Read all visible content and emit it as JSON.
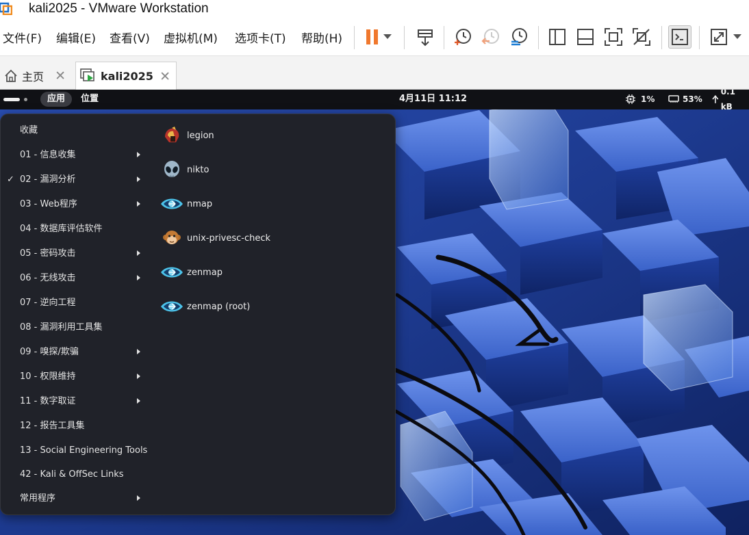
{
  "window": {
    "title": "kali2025 - VMware Workstation"
  },
  "menubar": {
    "items": [
      "文件(F)",
      "编辑(E)",
      "查看(V)",
      "虚拟机(M)",
      "选项卡(T)",
      "帮助(H)"
    ]
  },
  "toolbar": {
    "buttons": [
      "pause-icon",
      "dropdown-arrow-icon",
      "send-ctrl-alt-del-icon",
      "snapshot-take-icon",
      "snapshot-revert-icon",
      "snapshot-manager-icon",
      "show-library-icon",
      "thumbnail-bar-icon",
      "fullscreen-icon",
      "unity-icon",
      "console-view-icon",
      "stretch-icon"
    ],
    "accent": "#f0782d"
  },
  "tabs": [
    {
      "label": "主页",
      "icon": "home-icon"
    },
    {
      "label": "kali2025",
      "icon": "vm-running-icon"
    }
  ],
  "kali": {
    "topbar": {
      "apps": "应用",
      "places": "位置",
      "clock": "4月11日  11:12",
      "cpu": "1%",
      "memory": "53%",
      "network": "0.1 kB"
    },
    "menu": {
      "categories": [
        {
          "label": "收藏",
          "submenu": false,
          "checked": false
        },
        {
          "label": "01 - 信息收集",
          "submenu": true,
          "checked": false
        },
        {
          "label": "02 - 漏洞分析",
          "submenu": true,
          "checked": true
        },
        {
          "label": "03 - Web程序",
          "submenu": true,
          "checked": false
        },
        {
          "label": "04 - 数据库评估软件",
          "submenu": false,
          "checked": false
        },
        {
          "label": "05 - 密码攻击",
          "submenu": true,
          "checked": false
        },
        {
          "label": "06 - 无线攻击",
          "submenu": true,
          "checked": false
        },
        {
          "label": "07 - 逆向工程",
          "submenu": false,
          "checked": false
        },
        {
          "label": "08 - 漏洞利用工具集",
          "submenu": false,
          "checked": false
        },
        {
          "label": "09 - 嗅探/欺骗",
          "submenu": true,
          "checked": false
        },
        {
          "label": "10 - 权限维持",
          "submenu": true,
          "checked": false
        },
        {
          "label": "11 - 数字取证",
          "submenu": true,
          "checked": false
        },
        {
          "label": "12 - 报告工具集",
          "submenu": false,
          "checked": false
        },
        {
          "label": "13 - Social Engineering Tools",
          "submenu": false,
          "checked": false
        },
        {
          "label": "42 - Kali & OffSec Links",
          "submenu": false,
          "checked": false
        },
        {
          "label": "常用程序",
          "submenu": true,
          "checked": false
        }
      ],
      "apps": [
        {
          "label": "legion",
          "icon": "legion-helmet-icon"
        },
        {
          "label": "nikto",
          "icon": "nikto-alien-icon"
        },
        {
          "label": "nmap",
          "icon": "nmap-eye-icon"
        },
        {
          "label": "unix-privesc-check",
          "icon": "monkey-icon"
        },
        {
          "label": "zenmap",
          "icon": "nmap-eye-icon"
        },
        {
          "label": "zenmap (root)",
          "icon": "nmap-eye-icon"
        }
      ]
    }
  }
}
